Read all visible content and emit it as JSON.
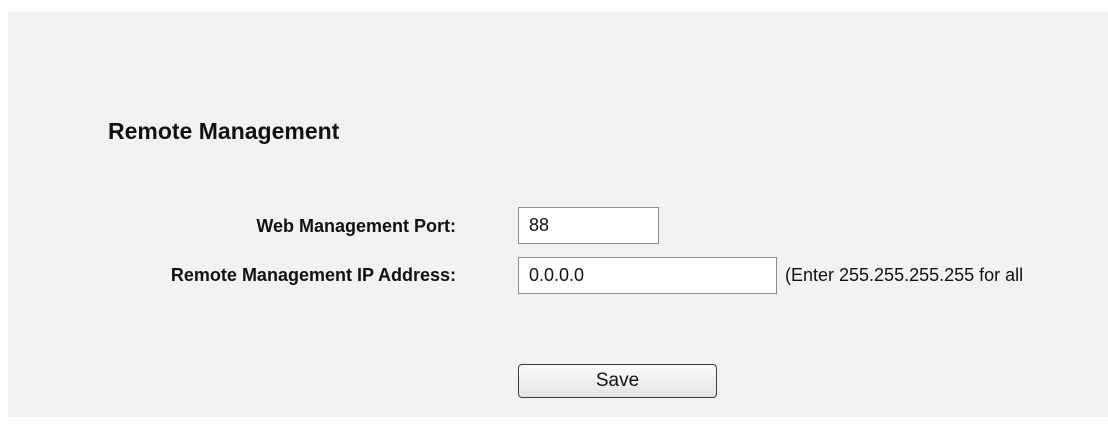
{
  "page": {
    "title": "Remote Management"
  },
  "form": {
    "port_label": "Web Management Port:",
    "port_value": "88",
    "ip_label": "Remote Management IP Address:",
    "ip_value": "0.0.0.0",
    "ip_hint": "(Enter 255.255.255.255 for all",
    "save_label": "Save"
  },
  "colors": {
    "panel_background": "#f2f2f2",
    "text": "#111111"
  }
}
